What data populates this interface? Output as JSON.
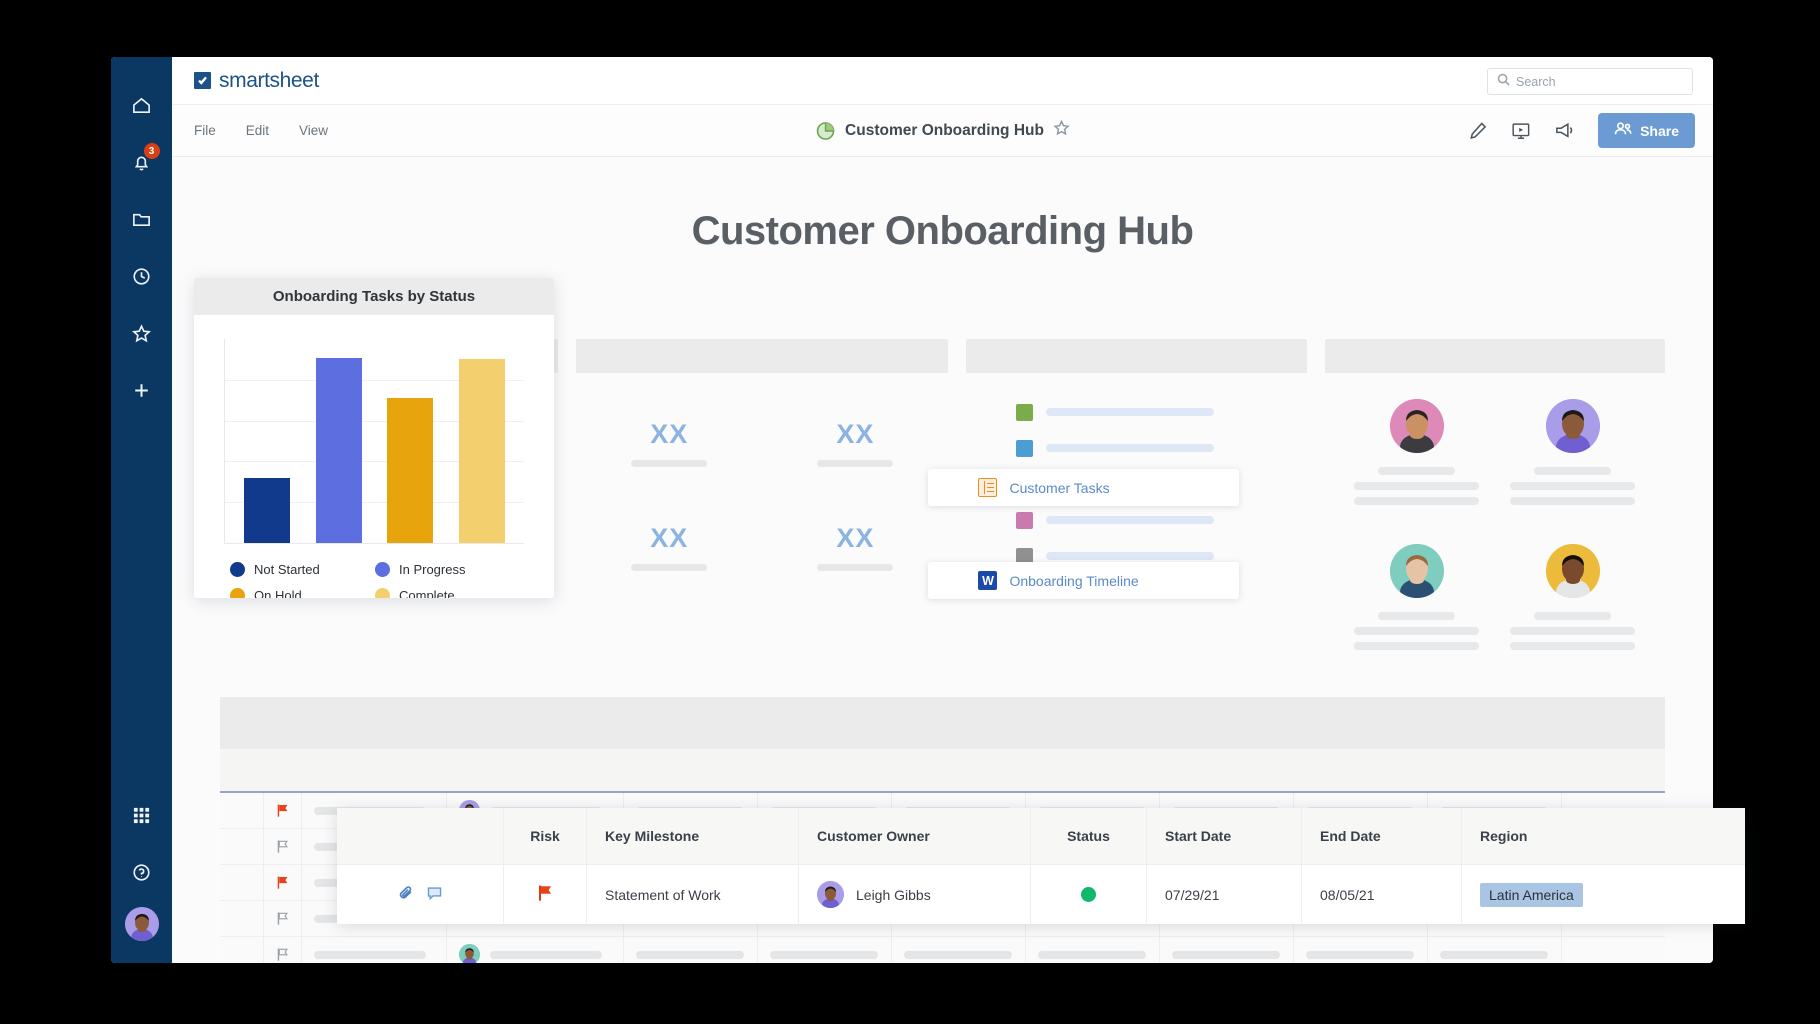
{
  "brand": {
    "name": "smartsheet",
    "mark_icon": "check-mark-icon"
  },
  "search": {
    "placeholder": "Search",
    "value": "",
    "icon": "search-icon"
  },
  "rail": {
    "items": [
      {
        "name": "home",
        "icon": "home-icon"
      },
      {
        "name": "notifications",
        "icon": "bell-icon",
        "badge": "3"
      },
      {
        "name": "browse",
        "icon": "folder-icon"
      },
      {
        "name": "recents",
        "icon": "clock-icon"
      },
      {
        "name": "favorites",
        "icon": "star-icon"
      },
      {
        "name": "create",
        "icon": "plus-icon"
      }
    ],
    "bottom": [
      {
        "name": "apps",
        "icon": "grid-apps-icon"
      },
      {
        "name": "help",
        "icon": "question-circle-icon"
      },
      {
        "name": "account",
        "icon": "user-avatar"
      }
    ]
  },
  "menubar": {
    "items": [
      {
        "label": "File"
      },
      {
        "label": "Edit"
      },
      {
        "label": "View"
      }
    ],
    "doc_title": "Customer Onboarding Hub",
    "doc_icon": "pie-chart-icon",
    "favorite_icon": "star-outline-icon",
    "actions": [
      {
        "name": "edit",
        "icon": "pencil-icon"
      },
      {
        "name": "present",
        "icon": "presentation-play-icon"
      },
      {
        "name": "announcements",
        "icon": "megaphone-icon"
      }
    ],
    "share_label": "Share",
    "share_icon": "people-icon"
  },
  "page": {
    "title": "Customer Onboarding Hub"
  },
  "chart_data": {
    "type": "bar",
    "title": "Onboarding Tasks by Status",
    "categories": [
      "Not Started",
      "In Progress",
      "On Hold",
      "Complete"
    ],
    "values": [
      35,
      100,
      78,
      99
    ],
    "colors": [
      "#123a8c",
      "#5c6ee0",
      "#e8a40c",
      "#f3cf6e"
    ],
    "xlabel": "",
    "ylabel": "",
    "ylim": [
      0,
      110
    ],
    "grid": true,
    "gridline_count": 5,
    "legend": {
      "position": "bottom",
      "entries": [
        {
          "label": "Not Started",
          "color": "#123a8c"
        },
        {
          "label": "In Progress",
          "color": "#5c6ee0"
        },
        {
          "label": "On Hold",
          "color": "#e8a40c"
        },
        {
          "label": "Complete",
          "color": "#f3cf6e"
        }
      ]
    }
  },
  "metrics_widget": {
    "tiles": [
      {
        "value": "XX"
      },
      {
        "value": "XX"
      },
      {
        "value": "XX"
      },
      {
        "value": "XX"
      }
    ]
  },
  "links_widget": {
    "rows": [
      {
        "swatch": "#7cab4b"
      },
      {
        "swatch": "#4a9ed4"
      },
      {
        "swatch": "#c97bb0"
      },
      {
        "swatch": "#919191"
      }
    ],
    "cards": [
      {
        "label": "Customer Tasks",
        "icon": "sheet-icon"
      },
      {
        "label": "Onboarding Timeline",
        "icon": "word-doc-icon"
      }
    ]
  },
  "people_widget": {
    "people": [
      {
        "avatar_bg": "#dd8ab8",
        "avatar_name": "person-1-avatar"
      },
      {
        "avatar_bg": "#a99ce8",
        "avatar_name": "person-2-avatar"
      },
      {
        "avatar_bg": "#7ecdbe",
        "avatar_name": "person-3-avatar"
      },
      {
        "avatar_bg": "#edbb3b",
        "avatar_name": "person-4-avatar"
      }
    ]
  },
  "grid_rows": [
    {
      "flag": "red",
      "avatar_bg": "#a99ce8"
    },
    {
      "flag": "gray",
      "avatar_bg": ""
    },
    {
      "flag": "red",
      "avatar_bg": ""
    },
    {
      "flag": "gray",
      "avatar_bg": ""
    },
    {
      "flag": "gray",
      "avatar_bg": "#7ecdbe"
    }
  ],
  "table": {
    "columns": [
      {
        "key": "icons",
        "label": ""
      },
      {
        "key": "risk",
        "label": "Risk"
      },
      {
        "key": "mile",
        "label": "Key Milestone"
      },
      {
        "key": "owner",
        "label": "Customer Owner"
      },
      {
        "key": "status",
        "label": "Status"
      },
      {
        "key": "start",
        "label": "Start Date"
      },
      {
        "key": "end",
        "label": "End Date"
      },
      {
        "key": "region",
        "label": "Region"
      }
    ],
    "rows": [
      {
        "attachment_icon": "paperclip-icon",
        "comment_icon": "comment-icon",
        "risk_icon": "red-flag-icon",
        "mile": "Statement of Work",
        "owner": "Leigh Gibbs",
        "owner_avatar_bg": "#a99ce8",
        "status_color": "#0fb86a",
        "start": "07/29/21",
        "end": "08/05/21",
        "region": "Latin America"
      }
    ]
  },
  "colors": {
    "rail_bg": "#0b3763",
    "brand_blue": "#1d5288",
    "share_blue": "#6b9bd2",
    "accent_link": "#5b8ac7",
    "status_green": "#0fb86a",
    "region_pill": "#aac4e3",
    "metric_blue": "#8cb4e0"
  }
}
